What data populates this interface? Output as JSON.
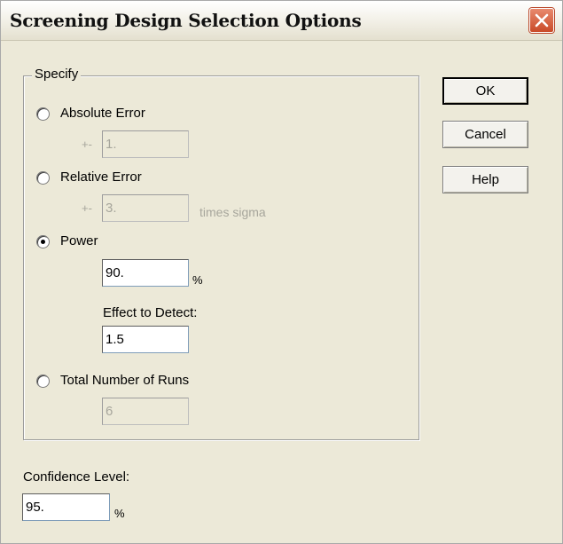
{
  "window": {
    "title": "Screening Design Selection Options",
    "close_icon": "close-x-icon",
    "close_color": "#d4532f"
  },
  "specify_group": {
    "legend": "Specify",
    "absolute_error": {
      "label": "Absolute Error",
      "prefix": "+-",
      "value": "1.",
      "selected": false,
      "enabled": false
    },
    "relative_error": {
      "label": "Relative Error",
      "prefix": "+-",
      "value": "3.",
      "suffix": "times sigma",
      "selected": false,
      "enabled": false
    },
    "power": {
      "label": "Power",
      "value": "90.",
      "unit": "%",
      "selected": true,
      "effect_label": "Effect to Detect:",
      "effect_value": "1.5"
    },
    "total_runs": {
      "label": "Total Number of Runs",
      "value": "6",
      "selected": false,
      "enabled": false
    }
  },
  "confidence": {
    "label": "Confidence Level:",
    "value": "95.",
    "unit": "%"
  },
  "buttons": {
    "ok": "OK",
    "cancel": "Cancel",
    "help": "Help"
  }
}
